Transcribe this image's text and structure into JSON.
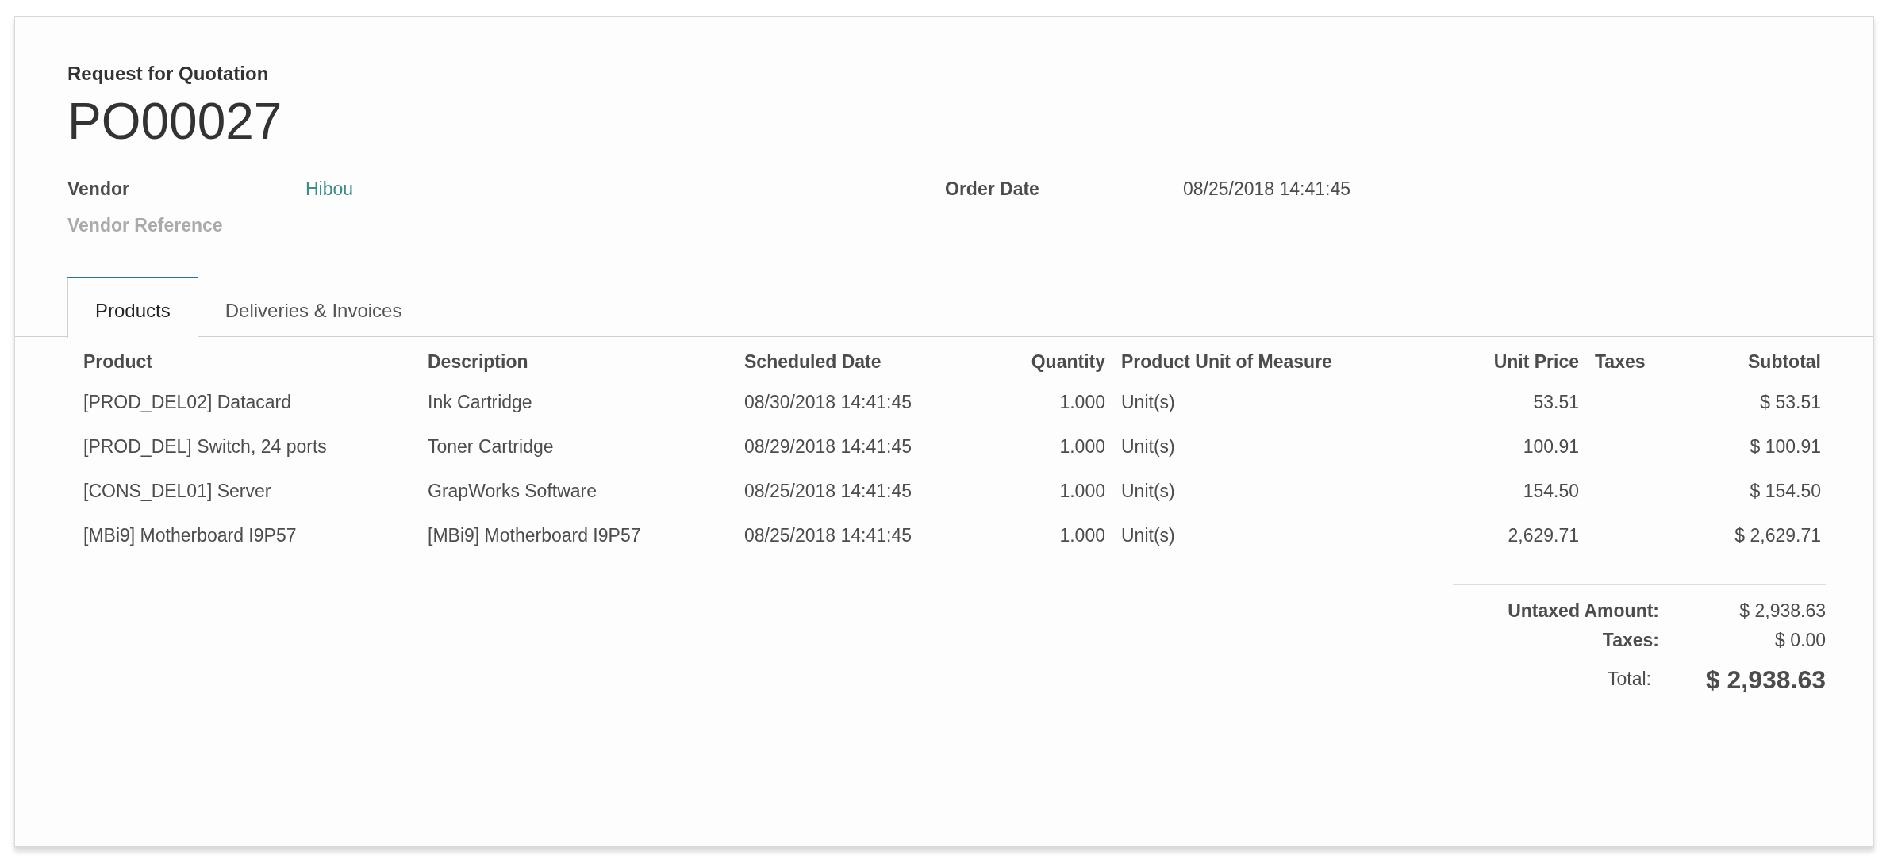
{
  "form": {
    "subtitle": "Request for Quotation",
    "name": "PO00027",
    "left_fields": [
      {
        "label": "Vendor",
        "value": "Hibou"
      },
      {
        "label": "Vendor Reference"
      }
    ],
    "right_fields": [
      {
        "label": "Order Date",
        "value": "08/25/2018 14:41:45"
      }
    ]
  },
  "tabs": [
    {
      "label": "Products",
      "selected": true
    },
    {
      "label": "Deliveries & Invoices",
      "selected": false
    }
  ],
  "table": {
    "columns": [
      "Product",
      "Description",
      "Scheduled Date",
      "Quantity",
      "Product Unit of Measure",
      "Unit Price",
      "Taxes",
      "Subtotal"
    ],
    "rows": [
      {
        "product": "[PROD_DEL02] Datacard",
        "description": "Ink Cartridge",
        "scheduled_date": "08/30/2018 14:41:45",
        "quantity": "1.000",
        "unit": "Unit(s)",
        "unit_price": "53.51",
        "subtotal": "$ 53.51"
      },
      {
        "product": "[PROD_DEL] Switch, 24 ports",
        "description": "Toner Cartridge",
        "scheduled_date": "08/29/2018 14:41:45",
        "quantity": "1.000",
        "unit": "Unit(s)",
        "unit_price": "100.91",
        "subtotal": "$ 100.91"
      },
      {
        "product": "[CONS_DEL01] Server",
        "description": "GrapWorks Software",
        "scheduled_date": "08/25/2018 14:41:45",
        "quantity": "1.000",
        "unit": "Unit(s)",
        "unit_price": "154.50",
        "subtotal": "$ 154.50"
      },
      {
        "product": "[MBi9] Motherboard I9P57",
        "description": "[MBi9] Motherboard I9P57",
        "scheduled_date": "08/25/2018 14:41:45",
        "quantity": "1.000",
        "unit": "Unit(s)",
        "unit_price": "2,629.71",
        "subtotal": "$ 2,629.71"
      }
    ]
  },
  "totals": {
    "untaxed_label": "Untaxed Amount:",
    "untaxed": "$ 2,938.63",
    "taxes_label": "Taxes:",
    "taxes": "$ 0.00",
    "total_label": "Total:",
    "total": "$ 2,938.63"
  }
}
